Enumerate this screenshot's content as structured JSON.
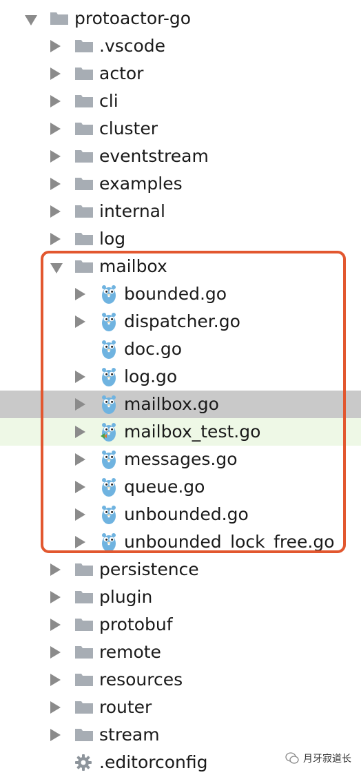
{
  "tree": [
    {
      "label": "protoactor-go",
      "kind": "folder",
      "arrow": "open",
      "depth": 0
    },
    {
      "label": ".vscode",
      "kind": "folder",
      "arrow": "closed",
      "depth": 1
    },
    {
      "label": "actor",
      "kind": "folder",
      "arrow": "closed",
      "depth": 1
    },
    {
      "label": "cli",
      "kind": "folder",
      "arrow": "closed",
      "depth": 1
    },
    {
      "label": "cluster",
      "kind": "folder",
      "arrow": "closed",
      "depth": 1
    },
    {
      "label": "eventstream",
      "kind": "folder",
      "arrow": "closed",
      "depth": 1
    },
    {
      "label": "examples",
      "kind": "folder",
      "arrow": "closed",
      "depth": 1
    },
    {
      "label": "internal",
      "kind": "folder",
      "arrow": "closed",
      "depth": 1
    },
    {
      "label": "log",
      "kind": "folder",
      "arrow": "closed",
      "depth": 1
    },
    {
      "label": "mailbox",
      "kind": "folder",
      "arrow": "open",
      "depth": 1
    },
    {
      "label": "bounded.go",
      "kind": "go",
      "arrow": "closed",
      "depth": 2
    },
    {
      "label": "dispatcher.go",
      "kind": "go",
      "arrow": "closed",
      "depth": 2
    },
    {
      "label": "doc.go",
      "kind": "go",
      "arrow": "none",
      "depth": 2
    },
    {
      "label": "log.go",
      "kind": "go",
      "arrow": "closed",
      "depth": 2
    },
    {
      "label": "mailbox.go",
      "kind": "go",
      "arrow": "closed",
      "depth": 2,
      "state": "selected"
    },
    {
      "label": "mailbox_test.go",
      "kind": "go-test",
      "arrow": "closed",
      "depth": 2,
      "state": "modified"
    },
    {
      "label": "messages.go",
      "kind": "go",
      "arrow": "closed",
      "depth": 2
    },
    {
      "label": "queue.go",
      "kind": "go",
      "arrow": "closed",
      "depth": 2
    },
    {
      "label": "unbounded.go",
      "kind": "go",
      "arrow": "closed",
      "depth": 2
    },
    {
      "label": "unbounded_lock_free.go",
      "kind": "go",
      "arrow": "closed",
      "depth": 2
    },
    {
      "label": "persistence",
      "kind": "folder",
      "arrow": "closed",
      "depth": 1
    },
    {
      "label": "plugin",
      "kind": "folder",
      "arrow": "closed",
      "depth": 1
    },
    {
      "label": "protobuf",
      "kind": "folder",
      "arrow": "closed",
      "depth": 1
    },
    {
      "label": "remote",
      "kind": "folder",
      "arrow": "closed",
      "depth": 1
    },
    {
      "label": "resources",
      "kind": "folder",
      "arrow": "closed",
      "depth": 1
    },
    {
      "label": "router",
      "kind": "folder",
      "arrow": "closed",
      "depth": 1
    },
    {
      "label": "stream",
      "kind": "folder",
      "arrow": "closed",
      "depth": 1
    },
    {
      "label": ".editorconfig",
      "kind": "config",
      "arrow": "none",
      "depth": 1
    }
  ],
  "watermark": {
    "text": "月牙寂道长",
    "icon": "wechat-icon"
  },
  "colors": {
    "folder": "#a7adb4",
    "gopher": "#6fb3e0",
    "highlight_border": "#e2572f",
    "selected_row": "#c9c9c9",
    "modified_row": "#eef8e6",
    "test_marker": "#4aa24a"
  }
}
